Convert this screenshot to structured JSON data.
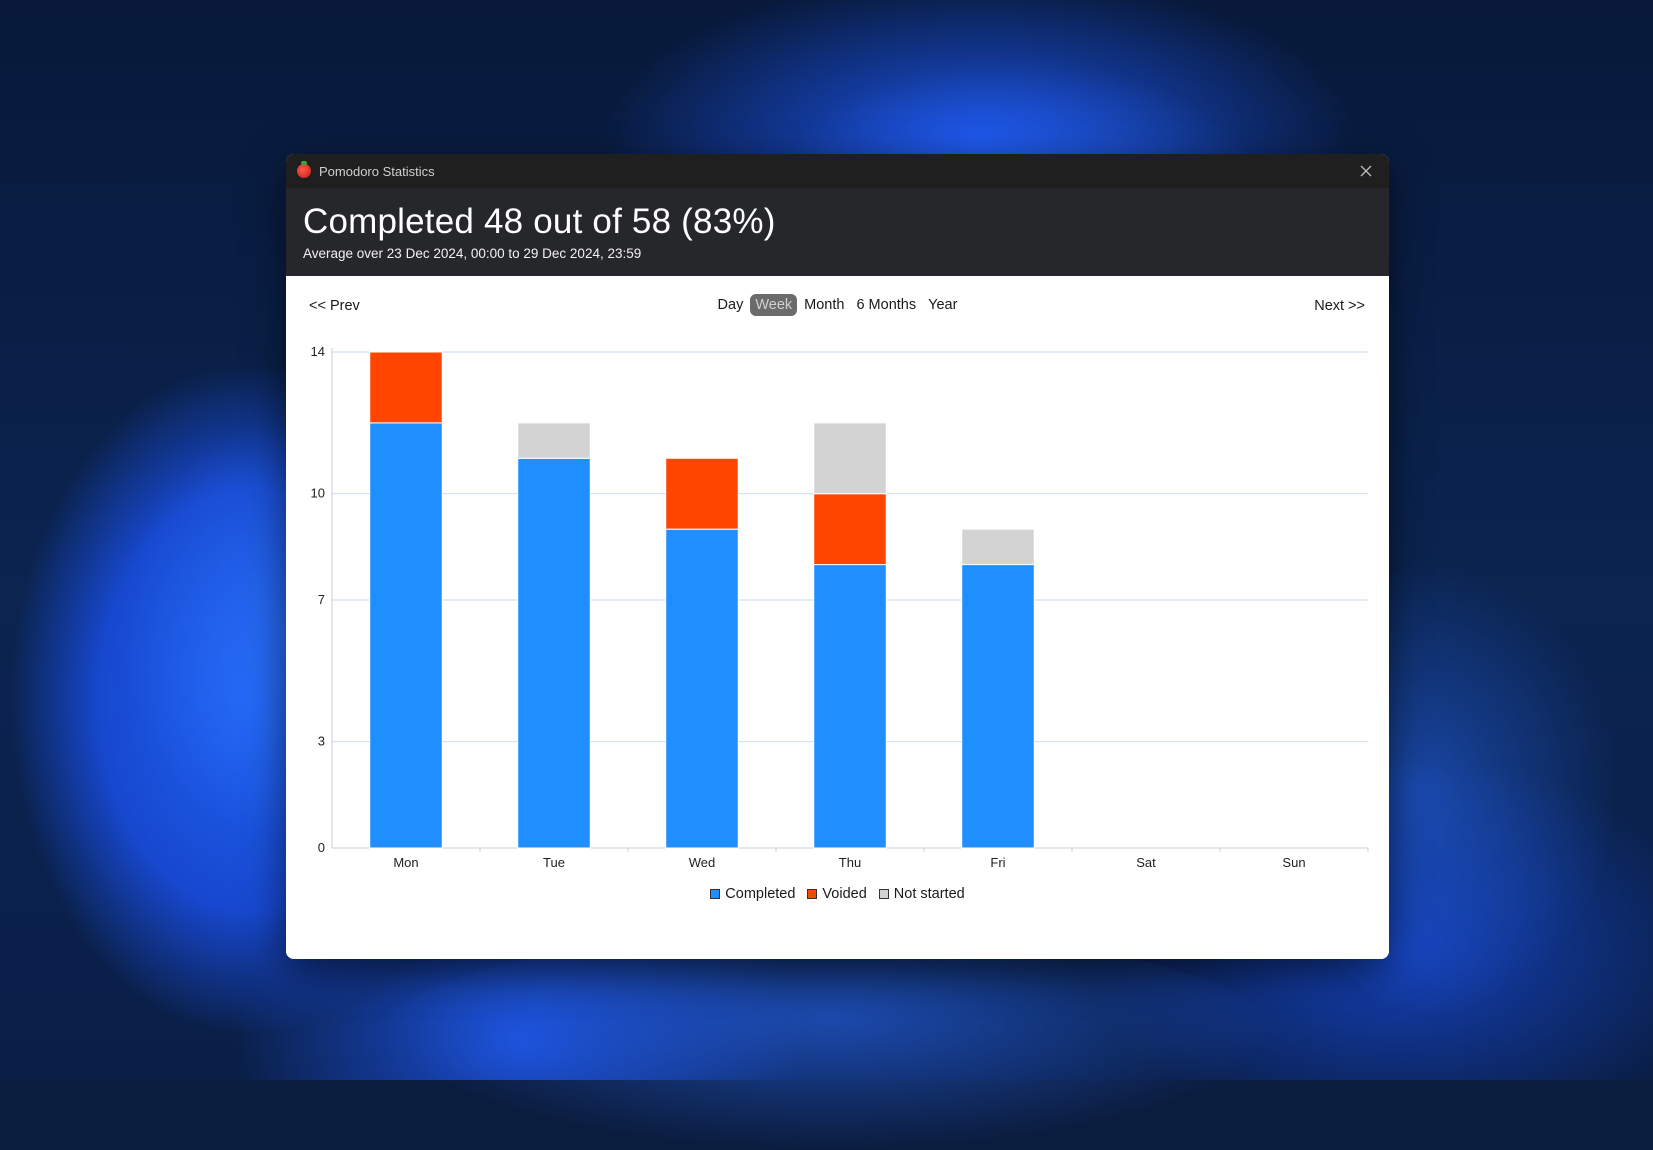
{
  "window": {
    "title": "Pomodoro Statistics"
  },
  "header": {
    "summary": "Completed 48 out of 58 (83%)",
    "range": "Average over 23 Dec 2024, 00:00 to 29 Dec 2024, 23:59"
  },
  "nav": {
    "prev": "<< Prev",
    "next": "Next >>",
    "tabs": [
      {
        "label": "Day",
        "active": false
      },
      {
        "label": "Week",
        "active": true
      },
      {
        "label": "Month",
        "active": false
      },
      {
        "label": "6 Months",
        "active": false
      },
      {
        "label": "Year",
        "active": false
      }
    ]
  },
  "icons": {
    "app": "tomato-icon",
    "close": "close-icon"
  },
  "colors": {
    "completed": "#1f8fff",
    "voided": "#ff4500",
    "not_started": "#d3d3d3",
    "grid": "#c9d9f5"
  },
  "chart_data": {
    "type": "bar",
    "stacked": true,
    "categories": [
      "Mon",
      "Tue",
      "Wed",
      "Thu",
      "Fri",
      "Sat",
      "Sun"
    ],
    "series": [
      {
        "name": "Completed",
        "values": [
          12,
          11,
          9,
          8,
          8,
          0,
          0
        ]
      },
      {
        "name": "Voided",
        "values": [
          2,
          0,
          2,
          2,
          0,
          0,
          0
        ]
      },
      {
        "name": "Not started",
        "values": [
          0,
          1,
          0,
          2,
          1,
          0,
          0
        ]
      }
    ],
    "yticks": [
      0,
      3,
      7,
      10,
      14
    ],
    "ylim": [
      0,
      14
    ],
    "grid": true,
    "legend": "bottom-center"
  }
}
